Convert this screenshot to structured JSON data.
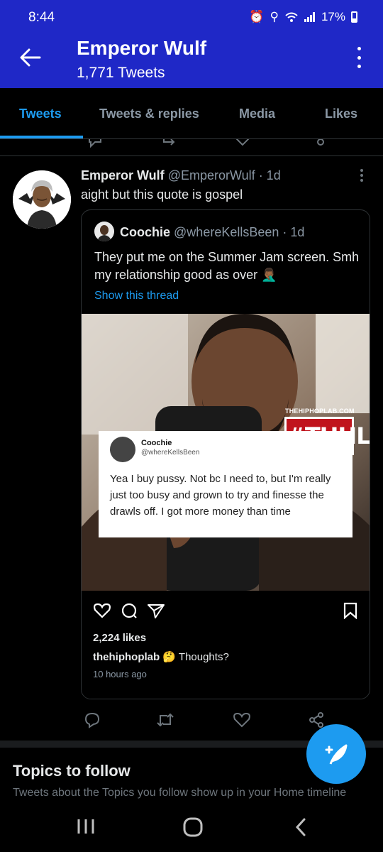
{
  "status_bar": {
    "time": "8:44",
    "battery": "17%"
  },
  "header": {
    "title": "Emperor Wulf",
    "subtitle": "1,771 Tweets"
  },
  "tabs": [
    {
      "label": "Tweets"
    },
    {
      "label": "Tweets & replies"
    },
    {
      "label": "Media"
    },
    {
      "label": "Likes"
    }
  ],
  "tweet": {
    "name": "Emperor Wulf",
    "handle": "@EmperorWulf",
    "time": "· 1d",
    "text": "aight but this quote is gospel",
    "quote": {
      "name": "Coochie",
      "handle": "@whereKellsBeen",
      "time": "· 1d",
      "text": "They put me on the Summer Jam screen. Smh my relationship good as over 🤦🏾‍♂️",
      "show_thread": "Show this thread",
      "image": {
        "watermark_site": "THEHIPHOPLAB.COM",
        "watermark_tag": "#THHL",
        "card_name": "Coochie",
        "card_handle": "@whereKellsBeen",
        "card_text": "Yea I buy pussy. Not bc I need to, but I'm really just too busy and grown to try and finesse the drawls off. I got more money than time"
      },
      "instagram": {
        "likes": "2,224 likes",
        "caption_user": "thehiphoplab",
        "caption_text": "🤔 Thoughts?",
        "time_ago": "10 hours ago"
      }
    },
    "actions": [
      "reply-icon",
      "retweet-icon",
      "like-icon",
      "share-icon"
    ]
  },
  "topics": {
    "title": "Topics to follow",
    "subtitle": "Tweets about the Topics you follow show up in your Home timeline"
  },
  "colors": {
    "app_bar": "#1f28c7",
    "accent": "#1d9bf0",
    "background": "#000000"
  }
}
